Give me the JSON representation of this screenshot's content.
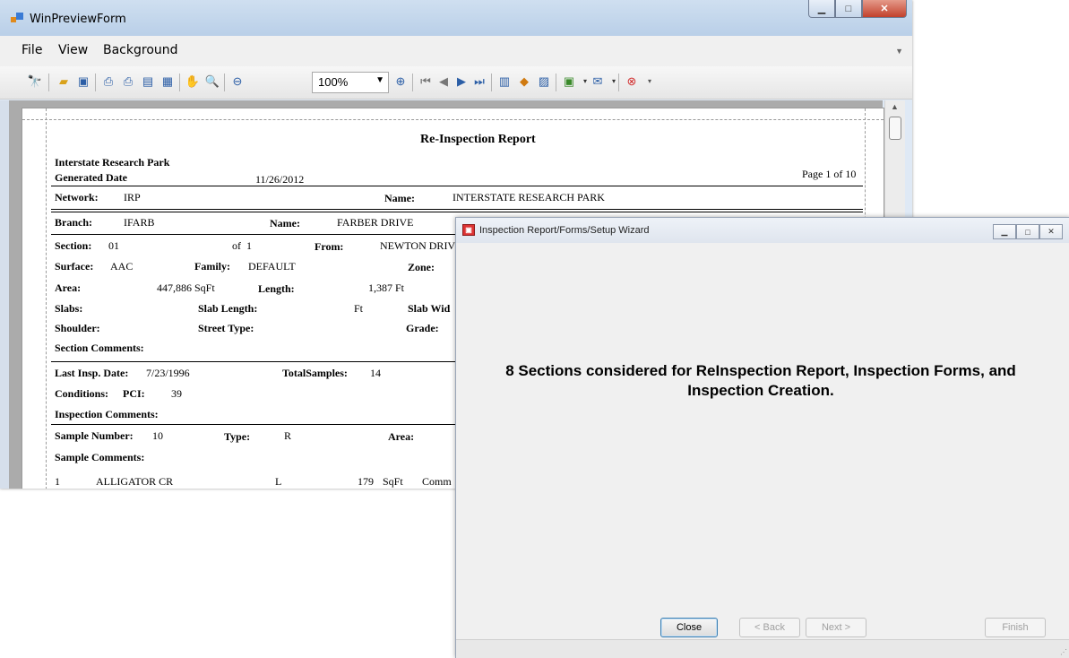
{
  "preview": {
    "title": "WinPreviewForm",
    "menu": [
      "File",
      "View",
      "Background"
    ],
    "zoom": "100%",
    "report": {
      "title": "Re-Inspection Report",
      "org": "Interstate Research Park",
      "generated_label": "Generated Date",
      "generated_value": "11/26/2012",
      "page": "Page 1 of 10",
      "network_label": "Network:",
      "network_value": "IRP",
      "network_name_label": "Name:",
      "network_name_value": "INTERSTATE RESEARCH PARK",
      "branch_label": "Branch:",
      "branch_value": "IFARB",
      "branch_name_label": "Name:",
      "branch_name_value": "FARBER DRIVE",
      "section_label": "Section:",
      "section_value": "01",
      "of_label": "of",
      "of_value": "1",
      "from_label": "From:",
      "from_value": "NEWTON DRIVE",
      "surface_label": "Surface:",
      "surface_value": "AAC",
      "family_label": "Family:",
      "family_value": "DEFAULT",
      "zone_label": "Zone:",
      "area_label": "Area:",
      "area_value": "447,886 SqFt",
      "length_label": "Length:",
      "length_value": "1,387 Ft",
      "slabs_label": "Slabs:",
      "slab_length_label": "Slab Length:",
      "ft_unit": "Ft",
      "slab_width_label": "Slab Wid",
      "shoulder_label": "Shoulder:",
      "street_type_label": "Street Type:",
      "grade_label": "Grade:",
      "section_comments_label": "Section Comments:",
      "last_insp_label": "Last Insp. Date:",
      "last_insp_value": "7/23/1996",
      "total_samples_label": "TotalSamples:",
      "total_samples_value": "14",
      "conditions_label": "Conditions:",
      "pci_label": "PCI:",
      "pci_value": "39",
      "insp_comments_label": "Inspection Comments:",
      "sample_number_label": "Sample Number:",
      "sample_number_value": "10",
      "type_label": "Type:",
      "type_value": "R",
      "area2_label": "Area:",
      "sample_comments_label": "Sample Comments:",
      "row1_num": "1",
      "row1_distress": "ALLIGATOR CR",
      "row1_sev": "L",
      "row1_qty": "179",
      "row1_unit": "SqFt",
      "row1_comm": "Comm"
    }
  },
  "wizard": {
    "title": "Inspection Report/Forms/Setup Wizard",
    "message": "8 Sections considered for ReInspection Report, Inspection Forms, and Inspection Creation.",
    "buttons": {
      "close": "Close",
      "back": "< Back",
      "next": "Next >",
      "finish": "Finish"
    }
  }
}
